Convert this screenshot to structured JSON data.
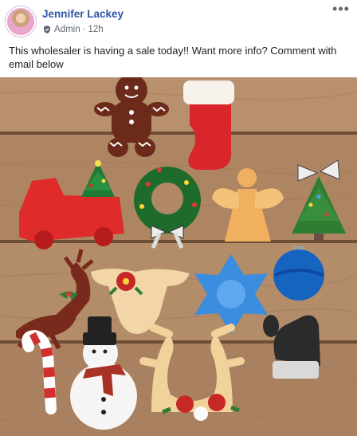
{
  "post": {
    "author": "Jennifer Lackey",
    "role": "Admin",
    "separator": "·",
    "time": "12h",
    "more_label": "•••",
    "text": "This wholesaler is having a sale today!! Want more info? Comment with email below"
  },
  "icons": {
    "avatar": "profile-photo",
    "role": "admin-shield-icon",
    "more": "more-options-icon"
  },
  "colors": {
    "author": "#2f56a6",
    "meta": "#606770",
    "text": "#1c1e21",
    "wood": "#b08866"
  }
}
